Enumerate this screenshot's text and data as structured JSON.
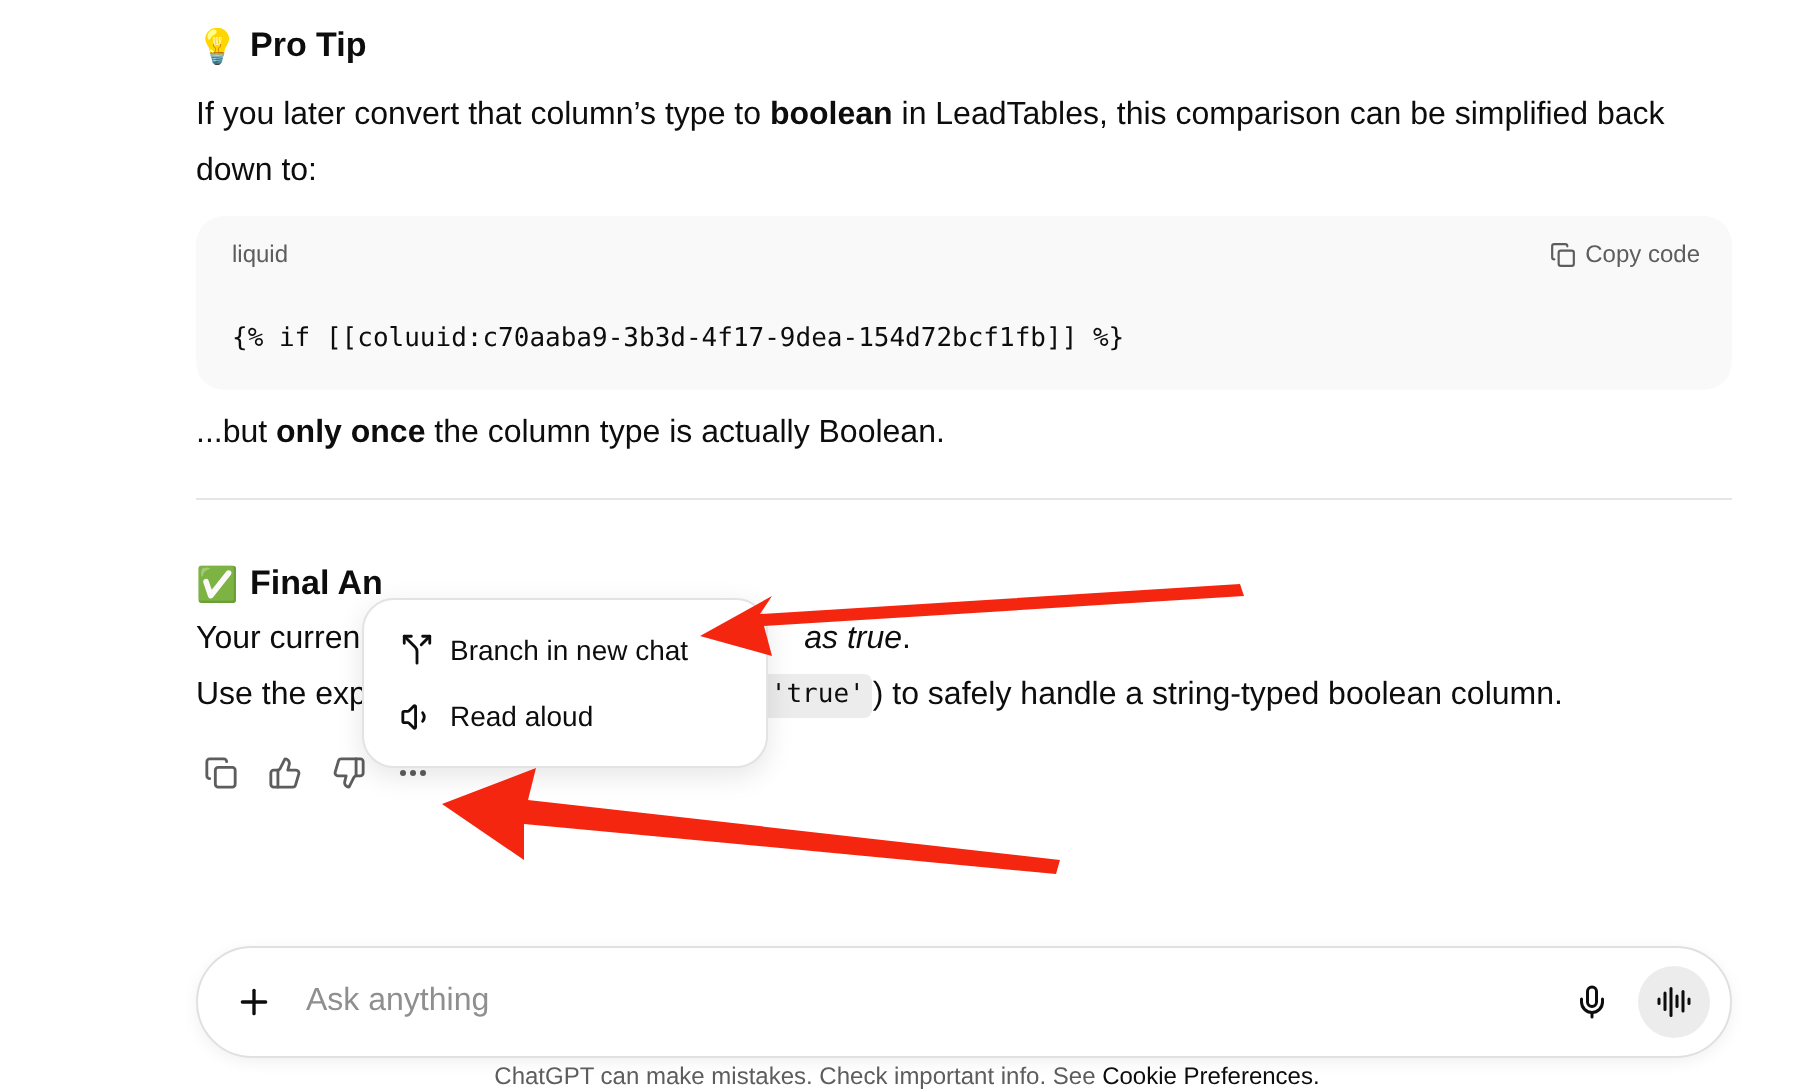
{
  "tip": {
    "emoji": "💡",
    "title": "Pro Tip",
    "paragraph": "If you later convert that column’s type to **boolean** in LeadTables, this comparison can be simplified back down to:"
  },
  "code_block": {
    "language": "liquid",
    "copy_label": "Copy code",
    "code": "{% if [[coluuid:c70aaba9-3b3d-4f17-9dea-154d72bcf1fb]] %}"
  },
  "note": "...but **only once** the column type is actually Boolean.",
  "final": {
    "emoji": "✅",
    "title_visible": "Final An",
    "line_1_left": "Your curren",
    "line_1_right": "*as true*.",
    "line_2_left": "Use the exp",
    "line_2_code": "'true'",
    "line_2_right": ") to safely handle a string-typed boolean column."
  },
  "actions": [
    {
      "kind": "copy"
    },
    {
      "kind": "like"
    },
    {
      "kind": "dislike"
    },
    {
      "kind": "more"
    }
  ],
  "menu": {
    "items": [
      {
        "kind": "branch",
        "label": "Branch in new chat"
      },
      {
        "kind": "speak",
        "label": "Read aloud"
      }
    ]
  },
  "composer": {
    "placeholder": "Ask anything"
  },
  "footer": {
    "text": "ChatGPT can make mistakes. Check important info. See",
    "link": "Cookie Preferences."
  }
}
